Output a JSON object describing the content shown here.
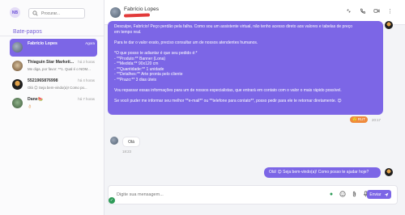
{
  "sidebar": {
    "avatar_initials": "NB",
    "search_placeholder": "Procurar...",
    "section_title": "Bate-papos",
    "chats": [
      {
        "name": "Fabrício Lopes",
        "time": "Agora",
        "preview": ""
      },
      {
        "name": "Thiaguin Star Marketi...",
        "time": "há 2 horas",
        "preview": "Me diga, por favor: **1. Qual é o NOM..."
      },
      {
        "name": "5521965876998",
        "time": "há 4 horas",
        "preview": "Olá 😊 Seja bem-vindo(a)! Como po..."
      },
      {
        "name": "Dane🍉",
        "time": "há 7 horas",
        "preview": "👌🏻"
      }
    ]
  },
  "header": {
    "contact_name": "Fabrício Lopes",
    "icons": [
      "compress-icon",
      "phone-icon",
      "video-icon",
      "more-icon"
    ]
  },
  "messages": {
    "bot_reply_lines": [
      "Desculpe, Fabrício! Peço perdão pela falha. Como sou um assistente virtual, não tenho acesso direto aos valores e tabelas de preço",
      "em tempo real.",
      "",
      "Para te dar o valor exato, preciso consultar um de nossos atendentes humanos.",
      "",
      "*O que posso te adiantar é que seu pedido é:*",
      "- **Produto:** Banner (Lona)",
      "- **Medida:** 90x120 cm",
      "- **Quantidade:** 1 unidade",
      "- **Detalhes:** Arte pronta pelo cliente",
      "- **Prazo:** 3 dias úteis",
      "",
      "Vou repassar essas informações para um de nossos especialistas, que entrará em contato com o valor o mais rápido possível.",
      "",
      "Se você puder me informar seu melhor **e-mail** ou **telefone para contato**, posso pedir para ele te retornar diretamente. 😊"
    ],
    "bot_reply_rating": "🙂 RUT",
    "bot_reply_time": "20:17",
    "incoming_text": "Olá",
    "incoming_time": "18:23",
    "welcome_text": "Olá! 😊 Seja bem-vindo(a)! Como posso te ajudar hoje?"
  },
  "composer": {
    "placeholder": "Digite sua mensagem...",
    "send_label": "Enviar"
  }
}
